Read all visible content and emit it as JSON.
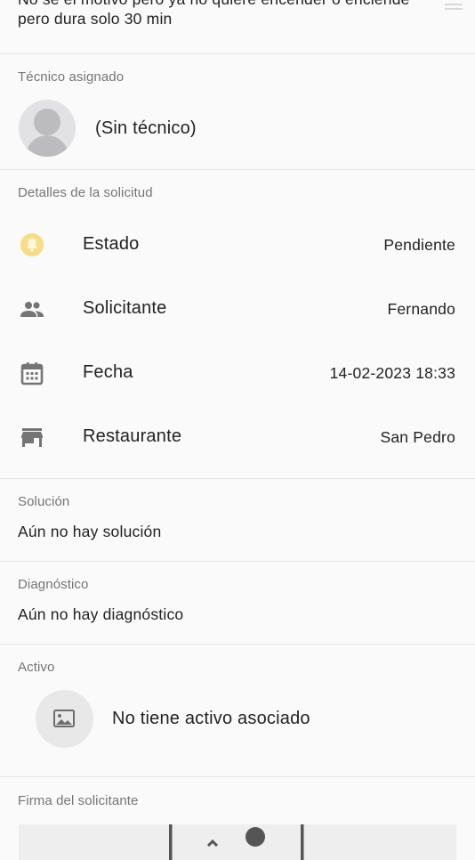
{
  "request": {
    "description_line1": "No se el motivo pero ya no quiere encender o enciende",
    "description_line2": "pero dura solo 30 min"
  },
  "technician": {
    "section_label": "Técnico asignado",
    "name": "(Sin técnico)"
  },
  "details": {
    "section_label": "Detalles de la solicitud",
    "rows": [
      {
        "icon": "bell-icon",
        "label": "Estado",
        "value": "Pendiente",
        "icon_color": "#f5d67a"
      },
      {
        "icon": "people-icon",
        "label": "Solicitante",
        "value": "Fernando",
        "icon_color": "#757575"
      },
      {
        "icon": "calendar-icon",
        "label": "Fecha",
        "value": "14-02-2023 18:33",
        "icon_color": "#757575"
      },
      {
        "icon": "store-icon",
        "label": "Restaurante",
        "value": "San Pedro",
        "icon_color": "#757575"
      }
    ]
  },
  "solution": {
    "section_label": "Solución",
    "text": "Aún no hay solución"
  },
  "diagnosis": {
    "section_label": "Diagnóstico",
    "text": "Aún no hay diagnóstico"
  },
  "asset": {
    "section_label": "Activo",
    "text": "No tiene activo asociado"
  },
  "signature": {
    "section_label": "Firma del solicitante"
  }
}
